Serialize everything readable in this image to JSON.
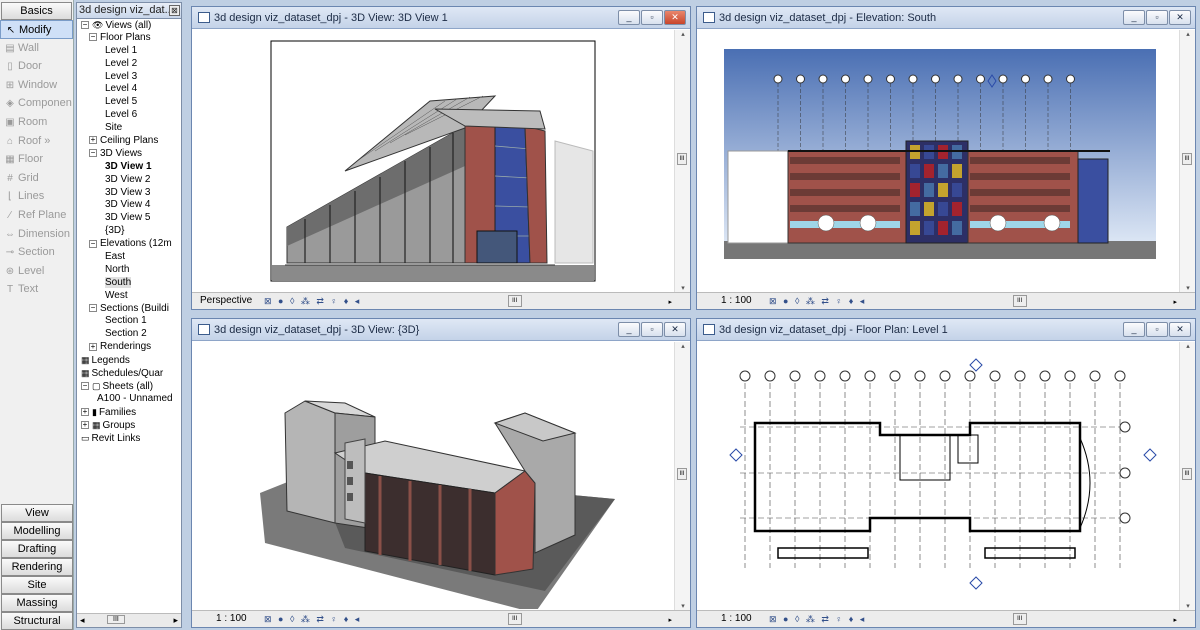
{
  "design_bar": {
    "top_tab": "Basics",
    "tools": [
      {
        "label": "Modify",
        "icon": "↖",
        "icon_name": "cursor-icon",
        "active": true
      },
      {
        "label": "Wall",
        "icon": "▤",
        "icon_name": "wall-icon"
      },
      {
        "label": "Door",
        "icon": "▯",
        "icon_name": "door-icon"
      },
      {
        "label": "Window",
        "icon": "⊞",
        "icon_name": "window-icon"
      },
      {
        "label": "Componen",
        "icon": "◈",
        "icon_name": "component-icon"
      },
      {
        "label": "Room",
        "icon": "▣",
        "icon_name": "room-icon"
      },
      {
        "label": "Roof »",
        "icon": "⌂",
        "icon_name": "roof-icon"
      },
      {
        "label": "Floor",
        "icon": "▦",
        "icon_name": "floor-icon"
      },
      {
        "label": "Grid",
        "icon": "#",
        "icon_name": "grid-icon"
      },
      {
        "label": "Lines",
        "icon": "⌊",
        "icon_name": "lines-icon"
      },
      {
        "label": "Ref Plane",
        "icon": "∕",
        "icon_name": "ref-plane-icon"
      },
      {
        "label": "Dimension",
        "icon": "⇔",
        "icon_name": "dimension-icon"
      },
      {
        "label": "Section",
        "icon": "⊸",
        "icon_name": "section-icon"
      },
      {
        "label": "Level",
        "icon": "⊛",
        "icon_name": "level-icon"
      },
      {
        "label": "Text",
        "icon": "T",
        "icon_name": "text-icon"
      }
    ],
    "bottom_tabs": [
      "View",
      "Modelling",
      "Drafting",
      "Rendering",
      "Site",
      "Massing",
      "Structural"
    ]
  },
  "project_browser": {
    "title": "3d design viz_dat...",
    "close": "⊠",
    "tree": [
      {
        "indent": 0,
        "toggle": "−",
        "icon": "👁",
        "label": "Views (all)"
      },
      {
        "indent": 1,
        "toggle": "−",
        "label": "Floor Plans"
      },
      {
        "indent": 3,
        "label": "Level 1"
      },
      {
        "indent": 3,
        "label": "Level 2"
      },
      {
        "indent": 3,
        "label": "Level 3"
      },
      {
        "indent": 3,
        "label": "Level 4"
      },
      {
        "indent": 3,
        "label": "Level 5"
      },
      {
        "indent": 3,
        "label": "Level 6"
      },
      {
        "indent": 3,
        "label": "Site"
      },
      {
        "indent": 1,
        "toggle": "+",
        "label": "Ceiling Plans"
      },
      {
        "indent": 1,
        "toggle": "−",
        "label": "3D Views"
      },
      {
        "indent": 3,
        "label": "3D View 1",
        "bold": true
      },
      {
        "indent": 3,
        "label": "3D View 2"
      },
      {
        "indent": 3,
        "label": "3D View 3"
      },
      {
        "indent": 3,
        "label": "3D View 4"
      },
      {
        "indent": 3,
        "label": "3D View 5"
      },
      {
        "indent": 3,
        "label": "{3D}"
      },
      {
        "indent": 1,
        "toggle": "−",
        "label": "Elevations (12m"
      },
      {
        "indent": 3,
        "label": "East"
      },
      {
        "indent": 3,
        "label": "North"
      },
      {
        "indent": 3,
        "label": "South",
        "selected": true
      },
      {
        "indent": 3,
        "label": "West"
      },
      {
        "indent": 1,
        "toggle": "−",
        "label": "Sections (Buildi"
      },
      {
        "indent": 3,
        "label": "Section 1"
      },
      {
        "indent": 3,
        "label": "Section 2"
      },
      {
        "indent": 1,
        "toggle": "+",
        "label": "Renderings"
      },
      {
        "indent": 0,
        "icon": "▦",
        "label": "Legends"
      },
      {
        "indent": 0,
        "icon": "▦",
        "label": "Schedules/Quar"
      },
      {
        "indent": 0,
        "toggle": "−",
        "icon": "▢",
        "label": "Sheets (all)"
      },
      {
        "indent": 2,
        "label": "A100 - Unnamed"
      },
      {
        "indent": 0,
        "toggle": "+",
        "icon": "▮",
        "label": "Families"
      },
      {
        "indent": 0,
        "toggle": "+",
        "icon": "▦",
        "label": "Groups"
      },
      {
        "indent": 0,
        "icon": "▭",
        "label": "Revit Links"
      }
    ]
  },
  "views": [
    {
      "id": "v1",
      "title": "3d design viz_dataset_dpj - 3D View: 3D View 1",
      "scale": "Perspective",
      "active": true
    },
    {
      "id": "v2",
      "title": "3d design viz_dataset_dpj - Elevation: South",
      "scale": "1 : 100"
    },
    {
      "id": "v3",
      "title": "3d design viz_dataset_dpj - 3D View: {3D}",
      "scale": "1 : 100"
    },
    {
      "id": "v4",
      "title": "3d design viz_dataset_dpj - Floor Plan: Level 1",
      "scale": "1 : 100"
    }
  ],
  "view_controls": {
    "minimize": "_",
    "restore": "▫",
    "close": "✕",
    "bar_icons": "⊠ ● ◊ ⁂ ⇄ ♀ ♦ ◂",
    "scroll_thumb": "III",
    "arrow_left": "◂",
    "arrow_right": "▸",
    "arrow_up": "▴",
    "arrow_down": "▾"
  },
  "colors": {
    "accent": "#6b86b0",
    "sky": "#c9dcf0",
    "facade_brick": "#a0524a",
    "glass": "#3a4fa0"
  }
}
